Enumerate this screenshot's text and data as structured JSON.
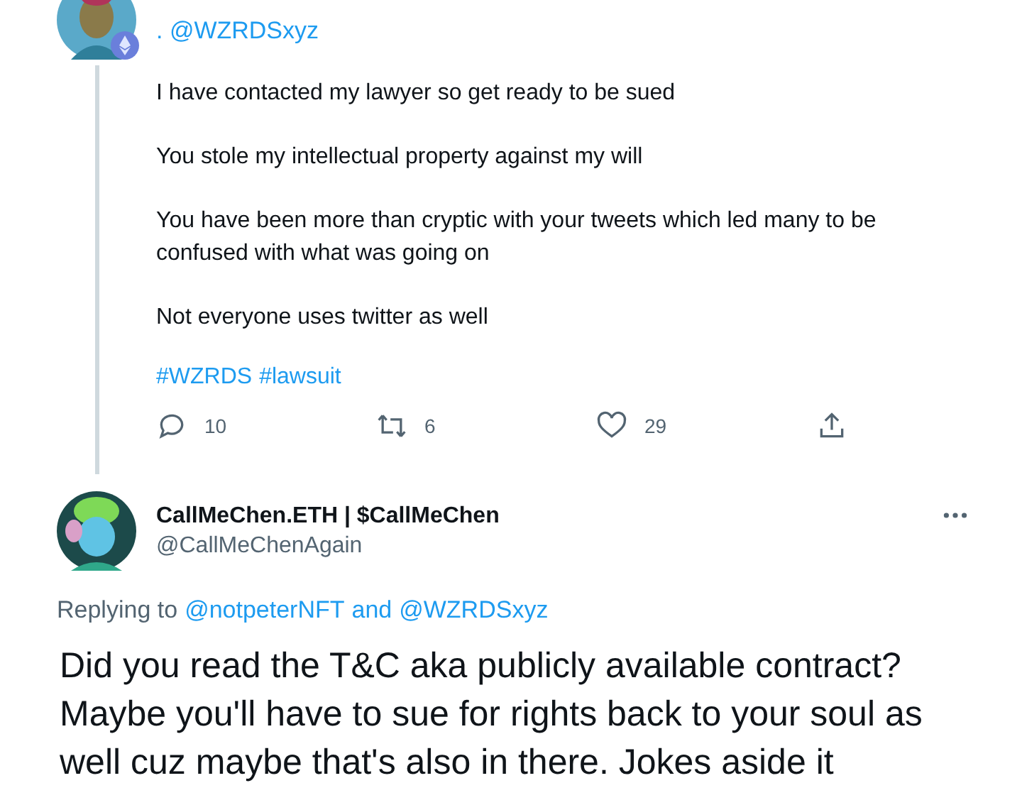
{
  "parent_tweet": {
    "mention": ". @WZRDSxyz",
    "paragraphs": [
      "I have contacted my lawyer so get ready to be sued",
      "You stole my intellectual property against my will",
      "You have been more than cryptic with your tweets which led many to be confused with what was going on",
      "Not everyone uses twitter as well"
    ],
    "hashtags": [
      "#WZRDS",
      "#lawsuit"
    ],
    "actions": [
      {
        "kind": "reply",
        "count": "10"
      },
      {
        "kind": "retweet",
        "count": "6"
      },
      {
        "kind": "like",
        "count": "29"
      },
      {
        "kind": "share"
      }
    ]
  },
  "reply_tweet": {
    "display_name": "CallMeChen.ETH | $CallMeChen",
    "handle": "@CallMeChenAgain",
    "replying_prefix": "Replying to",
    "replying_to": [
      "@notpeterNFT",
      "@WZRDSxyz"
    ],
    "replying_joiner": "and",
    "body": "Did you read the T&C aka publicly available contract? Maybe you'll have to sue for rights back to your soul as well cuz maybe that's also in there. Jokes aside it"
  }
}
